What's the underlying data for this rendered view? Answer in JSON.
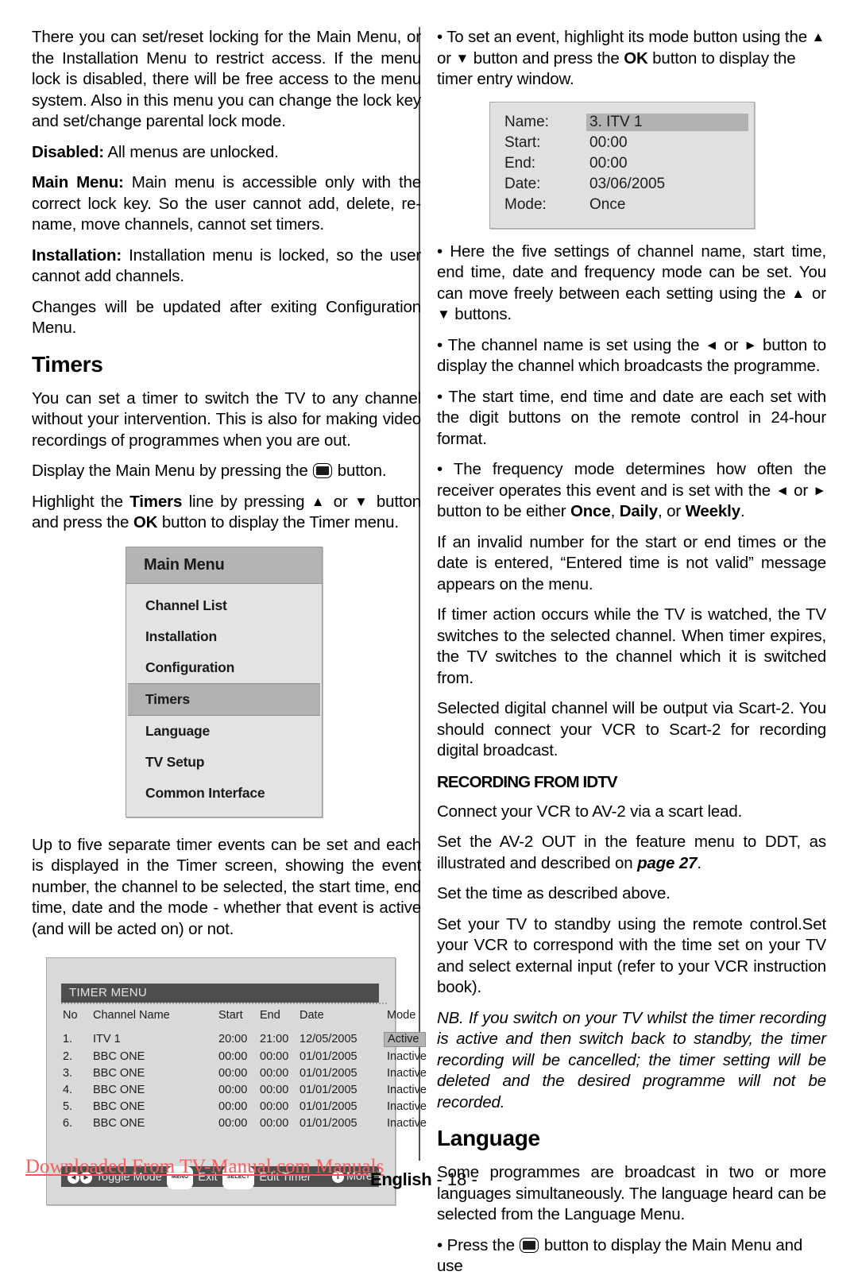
{
  "page": {
    "footer_watermark": "Downloaded From TV-Manual.com Manuals",
    "footer_language": "English",
    "footer_page_number": "- 18 -"
  },
  "left_column": {
    "paragraphs": {
      "intro": "There you can set/reset locking for the Main Menu, or the Installation Menu to restrict access. If the menu lock is disabled, there will be free access to the menu system. Also in this menu you can change the lock key and set/change parental lock mode.",
      "disabled_label": "Disabled:",
      "disabled_text": " All menus are unlocked.",
      "mainmenu_label": "Main Menu:",
      "mainmenu_text": " Main menu is accessible only with the correct lock key. So the user cannot add, delete, re-name, move channels, cannot set timers.",
      "installation_label": "Installation:",
      "installation_text": " Installation menu is locked, so the user cannot add channels.",
      "changes": "Changes will be updated after exiting Configuration Menu.",
      "timers_intro": "You can set a timer to switch the TV to any channel without your intervention. This is also for making video recordings of programmes when you are out.",
      "display_1": "Display the Main Menu by pressing the ",
      "display_2": " button.",
      "highlight_1": "Highlight the ",
      "highlight_timers": "Timers",
      "highlight_2": " line by pressing ",
      "highlight_3": " or ",
      "highlight_4": " button and press the ",
      "highlight_ok": "OK",
      "highlight_5": " button to display the Timer menu.",
      "after_fig": "Up to five separate timer events can be set and each is displayed in the Timer screen, showing the event number, the channel to be selected, the start time, end time, date and the mode - whether that event is active (and will be acted on) or not."
    },
    "headings": {
      "timers": "Timers"
    },
    "main_menu_osd": {
      "title": "Main Menu",
      "items": [
        {
          "label": "Channel List",
          "selected": false
        },
        {
          "label": "Installation",
          "selected": false
        },
        {
          "label": "Configuration",
          "selected": false
        },
        {
          "label": "Timers",
          "selected": true
        },
        {
          "label": "Language",
          "selected": false
        },
        {
          "label": "TV Setup",
          "selected": false
        },
        {
          "label": "Common Interface",
          "selected": false
        }
      ]
    },
    "timer_menu_osd": {
      "title": "TIMER MENU",
      "columns": [
        "No",
        "Channel Name",
        "Start",
        "End",
        "Date",
        "Mode"
      ],
      "rows": [
        {
          "no": "1.",
          "name": "ITV 1",
          "start": "20:00",
          "end": "21:00",
          "date": "12/05/2005",
          "mode": "Active",
          "highlighted": true
        },
        {
          "no": "2.",
          "name": "BBC ONE",
          "start": "00:00",
          "end": "00:00",
          "date": "01/01/2005",
          "mode": "Inactive",
          "highlighted": false
        },
        {
          "no": "3.",
          "name": "BBC ONE",
          "start": "00:00",
          "end": "00:00",
          "date": "01/01/2005",
          "mode": "Inactive",
          "highlighted": false
        },
        {
          "no": "4.",
          "name": "BBC ONE",
          "start": "00:00",
          "end": "00:00",
          "date": "01/01/2005",
          "mode": "Inactive",
          "highlighted": false
        },
        {
          "no": "5.",
          "name": "BBC ONE",
          "start": "00:00",
          "end": "00:00",
          "date": "01/01/2005",
          "mode": "Inactive",
          "highlighted": false
        },
        {
          "no": "6.",
          "name": "BBC ONE",
          "start": "00:00",
          "end": "00:00",
          "date": "01/01/2005",
          "mode": "Inactive",
          "highlighted": false
        }
      ],
      "footer": {
        "toggle_label": "Toggle Mode",
        "exit_key": "MENU",
        "exit_label": "Exit",
        "edit_key": "SELECT",
        "edit_label": "Edit Timer",
        "more_label": "More"
      }
    }
  },
  "right_column": {
    "paragraphs": {
      "set_event_1": "• To set an event, highlight its mode button using the ",
      "set_event_2": " or ",
      "set_event_3": " button and press the ",
      "set_event_ok": "OK",
      "set_event_4": " button to display the timer entry window.",
      "five_settings_1": "• Here the five settings of channel name, start time, end time, date and frequency mode can be set. You can move freely between each setting using the ",
      "five_settings_2": " or ",
      "five_settings_3": " buttons.",
      "channel_name_1": "• The channel name is set using the ",
      "channel_name_2": " or ",
      "channel_name_3": " button to display the channel which broadcasts the programme.",
      "start_time": "• The start time, end time and date are each set with the digit buttons on the remote control in 24-hour format.",
      "freq_1": " • The frequency mode determines how often the receiver operates this event and is set with the ",
      "freq_2": " or ",
      "freq_3": " button to be either ",
      "freq_once": "Once",
      "freq_comma": ", ",
      "freq_daily": "Daily",
      "freq_or": ", or ",
      "freq_weekly": "Weekly",
      "freq_end": ".",
      "invalid": "If an invalid number for the start or end times or the date is entered, “Entered time is not valid” message appears on the menu.",
      "timer_action": "If timer action occurs while the TV is watched, the TV switches to the selected channel. When timer expires, the TV switches to the channel which it is switched from.",
      "scart": "Selected digital channel will be output via Scart-2. You should connect your VCR to Scart-2 for recording digital broadcast.",
      "connect_vcr": "Connect your VCR to AV-2 via a scart lead.",
      "set_av2_1": "Set the AV-2 OUT in the feature menu to DDT, as illustrated and described on ",
      "set_av2_page": "page 27",
      "set_av2_2": ".",
      "set_time": "Set the time as described above.",
      "standby": "Set your TV to standby using the remote control.Set your VCR to correspond with the time set on your TV and select external input (refer to your VCR instruction book).",
      "nb": "NB. If you switch on your TV whilst the timer recording is active and then switch back to standby, the timer recording will be cancelled; the timer setting will be deleted and the desired programme will not be recorded.",
      "language_intro": "Some programmes are broadcast in two or more languages simultaneously. The language heard can be selected from the Language Menu.",
      "press_1": "• Press the ",
      "press_2": " button to display the Main Menu and use"
    },
    "headings": {
      "recording_from_idtv": "RECORDING FROM IDTV",
      "language": "Language"
    },
    "timer_entry_osd": {
      "rows": [
        {
          "label": "Name:",
          "value": "3. ITV 1",
          "highlighted": true
        },
        {
          "label": "Start:",
          "value": "00:00",
          "highlighted": false
        },
        {
          "label": "End:",
          "value": "00:00",
          "highlighted": false
        },
        {
          "label": "Date:",
          "value": "03/06/2005",
          "highlighted": false
        },
        {
          "label": "Mode:",
          "value": "Once",
          "highlighted": false
        }
      ]
    }
  },
  "glyphs": {
    "up_arrow": "▲",
    "down_arrow": "▼",
    "left_arrow": "◄",
    "right_arrow": "►",
    "left_circle": "◄",
    "right_circle": "►",
    "info": "i"
  }
}
